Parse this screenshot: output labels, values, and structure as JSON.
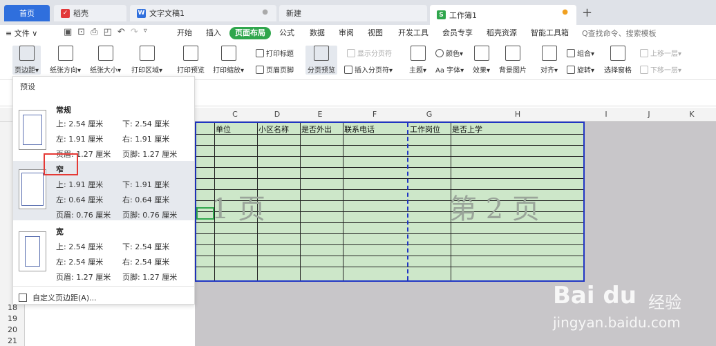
{
  "tabs": {
    "home": "首页",
    "daoke": "稻壳",
    "doc": "文字文稿1",
    "new": "新建",
    "sheet": "工作簿1",
    "doc_dot": "●",
    "sheet_dot": "●",
    "plus": "+"
  },
  "menu": {
    "file": "≡ 文件 ∨",
    "ribbon_tabs": [
      "开始",
      "插入",
      "页面布局",
      "公式",
      "数据",
      "审阅",
      "视图",
      "开发工具",
      "会员专享",
      "稻壳资源",
      "智能工具箱"
    ],
    "active_tab": "页面布局",
    "search": "Q查找命令、搜索模板"
  },
  "toolbar": {
    "margins": "页边距▾",
    "orientation": "纸张方向▾",
    "size": "纸张大小▾",
    "print_area": "打印区域▾",
    "print_preview": "打印预览",
    "print_scale": "打印缩放▾",
    "print_titles": "打印标题",
    "header_footer": "页眉页脚",
    "page_break_preview": "分页预览",
    "show_page_breaks": "显示分页符",
    "insert_page_break": "插入分页符▾",
    "theme": "主题▾",
    "colors": "颜色▾",
    "fonts": "Aa 字体▾",
    "effects": "效果▾",
    "background": "背景图片",
    "align": "对齐▾",
    "group": "组合▾",
    "rotate": "旋转▾",
    "selection_pane": "选择窗格",
    "bring_forward": "上移一层▾",
    "send_backward": "下移一层▾"
  },
  "columns": [
    "C",
    "D",
    "E",
    "F",
    "G",
    "H",
    "I",
    "J",
    "K"
  ],
  "header_row": [
    "单位",
    "小区名称",
    "是否外出",
    "联系电话",
    "工作岗位",
    "是否上学"
  ],
  "row_numbers": [
    "18",
    "19",
    "20",
    "21"
  ],
  "watermarks": [
    "1 页",
    "第 2 页"
  ],
  "panel": {
    "title": "预设",
    "presets": [
      {
        "name": "常规",
        "top": "上: 2.54 厘米",
        "bottom": "下: 2.54 厘米",
        "left": "左: 1.91 厘米",
        "right": "右: 1.91 厘米",
        "header": "页眉: 1.27 厘米",
        "footer": "页脚: 1.27 厘米"
      },
      {
        "name": "窄",
        "top": "上: 1.91 厘米",
        "bottom": "下: 1.91 厘米",
        "left": "左: 0.64 厘米",
        "right": "右: 0.64 厘米",
        "header": "页眉: 0.76 厘米",
        "footer": "页脚: 0.76 厘米"
      },
      {
        "name": "宽",
        "top": "上: 2.54 厘米",
        "bottom": "下: 2.54 厘米",
        "left": "左: 2.54 厘米",
        "right": "右: 2.54 厘米",
        "header": "页眉: 1.27 厘米",
        "footer": "页脚: 1.27 厘米"
      }
    ],
    "custom": "自定义页边距(A)..."
  },
  "watermark_logo": {
    "brand": "Bai du",
    "sub": "经验",
    "url": "jingyan.baidu.com"
  },
  "colors": {
    "accent_blue": "#2f6fdd",
    "active_green": "#2fa64c",
    "sheet_fill": "#cde7c9",
    "page_border": "#2035c4",
    "highlight_red": "#e53935"
  }
}
